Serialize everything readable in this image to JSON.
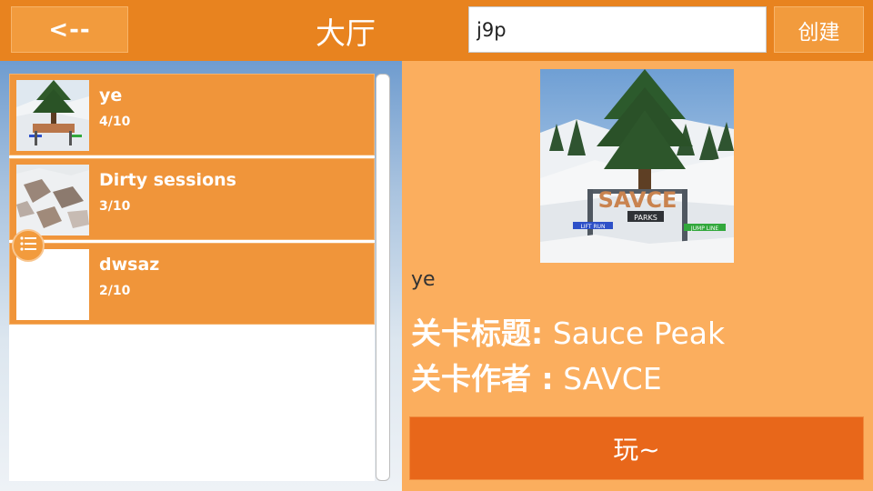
{
  "header": {
    "back_label": "<--",
    "title": "大厅",
    "search_value": "j9p",
    "create_label": "创建"
  },
  "rooms": [
    {
      "name": "ye",
      "count": "4/10"
    },
    {
      "name": "Dirty sessions",
      "count": "3/10"
    },
    {
      "name": "dwsaz",
      "count": "2/10"
    }
  ],
  "detail": {
    "creator": "ye",
    "level_title_label": "关卡标题:",
    "level_title": "Sauce Peak",
    "level_author_label": "关卡作者 :",
    "level_author": "SAVCE",
    "play_label": "玩~",
    "preview_sign_text": "SAVCE",
    "preview_sign_sub": "PARKS",
    "preview_left_sign": "LIFT RUN",
    "preview_right_sign": "JUMP LINE"
  },
  "colors": {
    "topbar": "#e8831f",
    "button": "#f29b3d",
    "list_item": "#f0953a",
    "right_panel": "#fbae5e",
    "play_button": "#e8671a"
  }
}
